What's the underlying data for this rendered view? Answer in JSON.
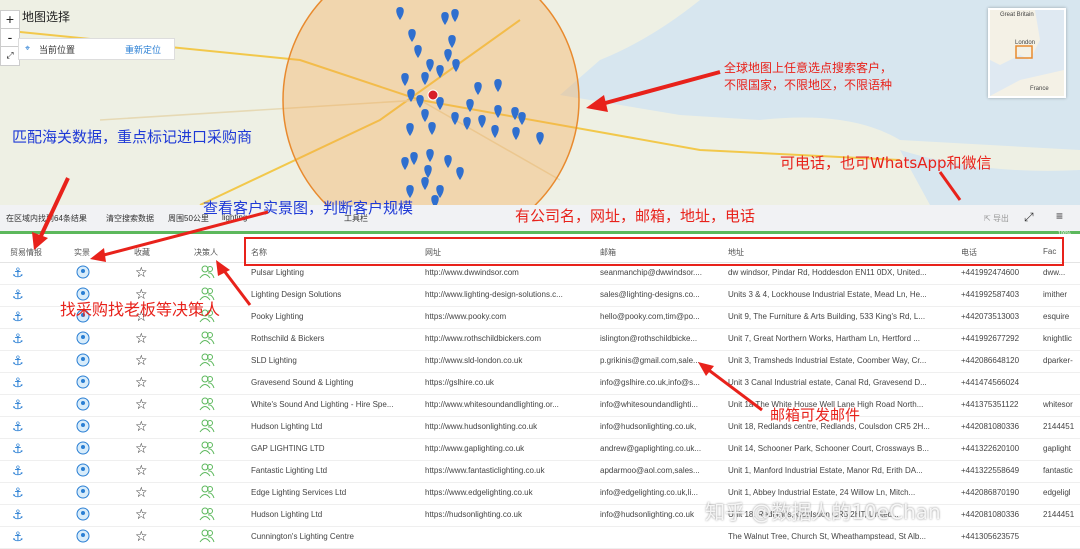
{
  "map": {
    "title": "地图选择",
    "zoom_in": "+",
    "zoom_out": "-",
    "location_label": "当前位置",
    "relocate_label": "重新定位",
    "minimap_labels": [
      "Great Britain",
      "London",
      "France"
    ]
  },
  "toolbar": {
    "result_count": "在区域内找到64条结果",
    "clear_search": "清空搜索数据",
    "radius": "周围50公里",
    "keyword": "lighting",
    "tools": "工具栏",
    "export": "导出",
    "progress": "100%"
  },
  "columns": [
    "贸易情报",
    "实景",
    "收藏",
    "决策人",
    "名称",
    "网址",
    "邮箱",
    "地址",
    "电话",
    "Fac"
  ],
  "rows": [
    {
      "name": "Pulsar Lighting",
      "url": "http://www.dwwindsor.com",
      "email": "seanmanchip@dwwindsor....",
      "address": "dw windsor, Pindar Rd, Hoddesdon EN11 0DX, United...",
      "phone": "+441992474600",
      "fb": "dww..."
    },
    {
      "name": "Lighting Design Solutions",
      "url": "http://www.lighting-design-solutions.c...",
      "email": "sales@lighting-designs.co...",
      "address": "Units 3 & 4, Lockhouse Industrial Estate, Mead Ln, He...",
      "phone": "+441992587403",
      "fb": "imither"
    },
    {
      "name": "Pooky Lighting",
      "url": "https://www.pooky.com",
      "email": "hello@pooky.com,tim@po...",
      "address": "Unit 9, The Furniture & Arts Building, 533 King's Rd, L...",
      "phone": "+442073513003",
      "fb": "esquire"
    },
    {
      "name": "Rothschild & Bickers",
      "url": "http://www.rothschildbickers.com",
      "email": "islington@rothschildbicke...",
      "address": "Unit 7, Great Northern Works, Hartham Ln, Hertford ...",
      "phone": "+441992677292",
      "fb": "knightlic"
    },
    {
      "name": "SLD Lighting",
      "url": "http://www.sld-london.co.uk",
      "email": "p.grikinis@gmail.com,sale...",
      "address": "Unit 3, Tramsheds Industrial Estate, Coomber Way, Cr...",
      "phone": "+442086648120",
      "fb": "dparker-"
    },
    {
      "name": "Gravesend Sound & Lighting",
      "url": "https://gslhire.co.uk",
      "email": "info@gslhire.co.uk,info@s...",
      "address": "Unit 3 Canal Industrial estate, Canal Rd, Gravesend D...",
      "phone": "+441474566024",
      "fb": ""
    },
    {
      "name": "White's Sound And Lighting - Hire Spe...",
      "url": "http://www.whitesoundandlighting.or...",
      "email": "info@whitesoundandlighti...",
      "address": "Unit 1a The White House Well Lane High Road North...",
      "phone": "+441375351122",
      "fb": "whitesor"
    },
    {
      "name": "Hudson Lighting Ltd",
      "url": "http://www.hudsonlighting.co.uk",
      "email": "info@hudsonlighting.co.uk,",
      "address": "Unit 18, Redlands centre, Redlands, Coulsdon CR5 2H...",
      "phone": "+442081080336",
      "fb": "2144451"
    },
    {
      "name": "GAP LIGHTING LTD",
      "url": "http://www.gaplighting.co.uk",
      "email": "andrew@gaplighting.co.uk...",
      "address": "Unit 14, Schooner Park, Schooner Court, Crossways B...",
      "phone": "+441322620100",
      "fb": "gaplight"
    },
    {
      "name": "Fantastic Lighting Ltd",
      "url": "https://www.fantasticlighting.co.uk",
      "email": "apdarmoo@aol.com,sales...",
      "address": "Unit 1, Manford Industrial Estate, Manor Rd, Erith DA...",
      "phone": "+441322558649",
      "fb": "fantastic"
    },
    {
      "name": "Edge Lighting Services Ltd",
      "url": "https://www.edgelighting.co.uk",
      "email": "info@edgelighting.co.uk,li...",
      "address": "Unit 1, Abbey Industrial Estate, 24 Willow Ln, Mitch...",
      "phone": "+442086870190",
      "fb": "edgeligl"
    },
    {
      "name": "Hudson Lighting Ltd",
      "url": "https://hudsonlighting.co.uk",
      "email": "info@hudsonlighting.co.uk",
      "address": "Unit 18, Redlands, Coulsdon CR5 2HT, United...",
      "phone": "+442081080336",
      "fb": "2144451"
    },
    {
      "name": "Cunnington's Lighting Centre",
      "url": "",
      "email": "",
      "address": "The Walnut Tree, Church St, Wheathampstead, St Alb...",
      "phone": "+441305623575",
      "fb": ""
    }
  ],
  "annotations": {
    "global_map": "全球地图上任意选点搜索客户，\n不限国家，不限地区，不限语种",
    "customs": "匹配海关数据，重点标记进口采购商",
    "phone": "可电话，也可WhatsApp和微信",
    "street_view": "查看客户实景图，判断客户规模",
    "company_info": "有公司名，网址，邮箱，地址，电话",
    "decision_maker": "找采购找老板等决策人",
    "email": "邮箱可发邮件",
    "watermark": "知乎 @数据人的10eChan"
  },
  "colors": {
    "accent_red": "#e8221b",
    "annotation_blue": "#1e39d6",
    "icon_blue": "#2a7fd4",
    "icon_green": "#5cb85c",
    "pin_blue": "#2f6fcf"
  }
}
